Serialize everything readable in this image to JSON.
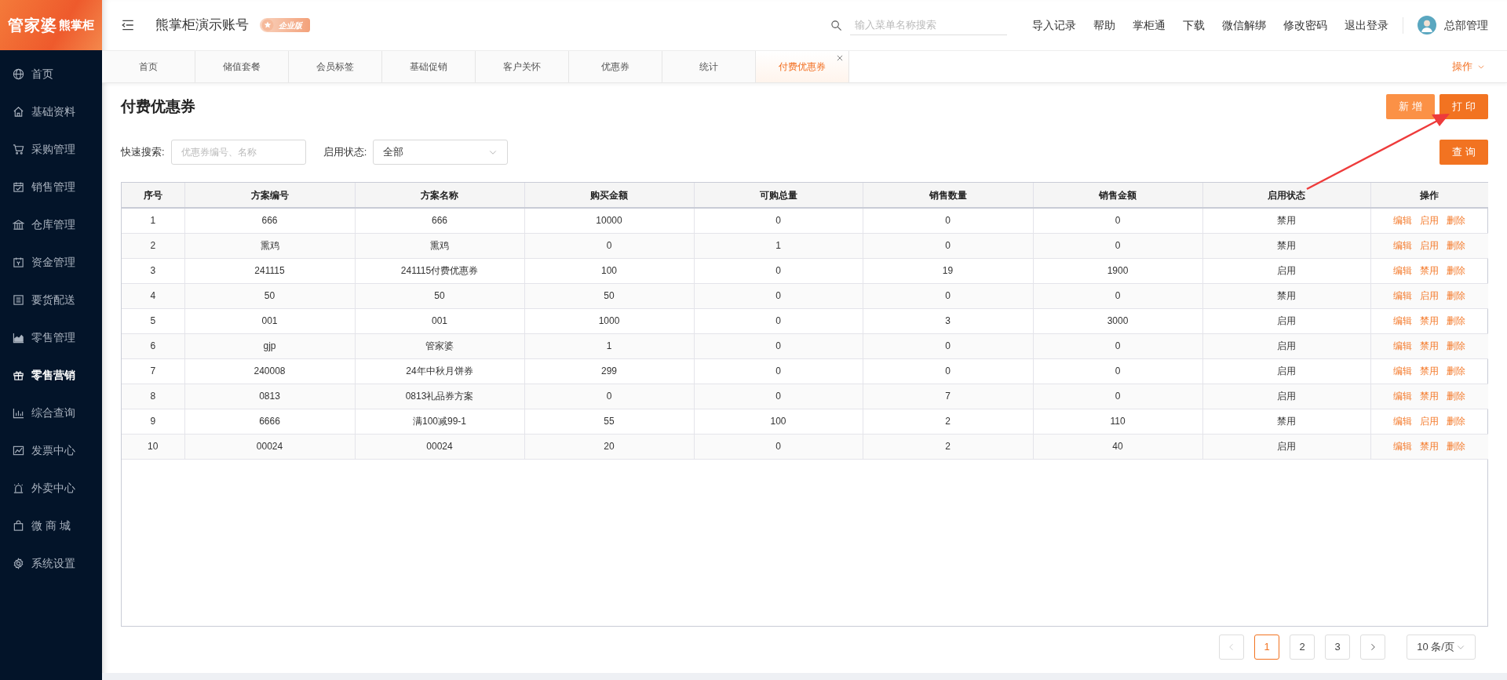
{
  "logo": {
    "brand": "管家婆",
    "product": "熊掌柜"
  },
  "sidebar": {
    "items": [
      {
        "label": "首页",
        "selected": false
      },
      {
        "label": "基础资料",
        "selected": false
      },
      {
        "label": "采购管理",
        "selected": false
      },
      {
        "label": "销售管理",
        "selected": false
      },
      {
        "label": "仓库管理",
        "selected": false
      },
      {
        "label": "资金管理",
        "selected": false
      },
      {
        "label": "要货配送",
        "selected": false
      },
      {
        "label": "零售管理",
        "selected": false
      },
      {
        "label": "零售营销",
        "selected": true
      },
      {
        "label": "综合查询",
        "selected": false
      },
      {
        "label": "发票中心",
        "selected": false
      },
      {
        "label": "外卖中心",
        "selected": false
      },
      {
        "label": "微 商 城",
        "selected": false
      },
      {
        "label": "系统设置",
        "selected": false
      }
    ]
  },
  "header": {
    "account": "熊掌柜演示账号",
    "edition": "企业版",
    "search": {
      "placeholder": "输入菜单名称搜索"
    },
    "links": [
      "导入记录",
      "帮助",
      "掌柜通",
      "下载",
      "微信解绑",
      "修改密码",
      "退出登录"
    ],
    "user": "总部管理"
  },
  "tabs": [
    {
      "label": "首页",
      "selected": false,
      "closable": false
    },
    {
      "label": "储值套餐",
      "selected": false,
      "closable": false
    },
    {
      "label": "会员标签",
      "selected": false,
      "closable": false
    },
    {
      "label": "基础促销",
      "selected": false,
      "closable": false
    },
    {
      "label": "客户关怀",
      "selected": false,
      "closable": false
    },
    {
      "label": "优惠券",
      "selected": false,
      "closable": false
    },
    {
      "label": "统计",
      "selected": false,
      "closable": false
    },
    {
      "label": "付费优惠券",
      "selected": true,
      "closable": true
    }
  ],
  "tab_menu": "操作",
  "page": {
    "title": "付费优惠券",
    "buttons": [
      {
        "label": "新 增",
        "kind": "light"
      },
      {
        "label": "打 印",
        "kind": "primary"
      }
    ],
    "filters": {
      "search_label": "快速搜索:",
      "search_placeholder": "优惠券编号、名称",
      "status_label": "启用状态:",
      "status_value": "全部"
    },
    "query_button": "查 询"
  },
  "table": {
    "columns": [
      "序号",
      "方案编号",
      "方案名称",
      "购买金额",
      "可购总量",
      "销售数量",
      "销售金额",
      "启用状态",
      "操作"
    ],
    "rows": [
      {
        "cells": [
          "1",
          "666",
          "666",
          "10000",
          "0",
          "0",
          "0",
          "禁用"
        ],
        "actions": [
          "编辑",
          "启用",
          "删除"
        ]
      },
      {
        "cells": [
          "2",
          "熏鸡",
          "熏鸡",
          "0",
          "1",
          "0",
          "0",
          "禁用"
        ],
        "actions": [
          "编辑",
          "启用",
          "删除"
        ]
      },
      {
        "cells": [
          "3",
          "241115",
          "241115付费优惠券",
          "100",
          "0",
          "19",
          "1900",
          "启用"
        ],
        "actions": [
          "编辑",
          "禁用",
          "删除"
        ]
      },
      {
        "cells": [
          "4",
          "50",
          "50",
          "50",
          "0",
          "0",
          "0",
          "禁用"
        ],
        "actions": [
          "编辑",
          "启用",
          "删除"
        ]
      },
      {
        "cells": [
          "5",
          "001",
          "001",
          "1000",
          "0",
          "3",
          "3000",
          "启用"
        ],
        "actions": [
          "编辑",
          "禁用",
          "删除"
        ]
      },
      {
        "cells": [
          "6",
          "gjp",
          "管家婆",
          "1",
          "0",
          "0",
          "0",
          "启用"
        ],
        "actions": [
          "编辑",
          "禁用",
          "删除"
        ]
      },
      {
        "cells": [
          "7",
          "240008",
          "24年中秋月饼券",
          "299",
          "0",
          "0",
          "0",
          "启用"
        ],
        "actions": [
          "编辑",
          "禁用",
          "删除"
        ]
      },
      {
        "cells": [
          "8",
          "0813",
          "0813礼品券方案",
          "0",
          "0",
          "7",
          "0",
          "启用"
        ],
        "actions": [
          "编辑",
          "禁用",
          "删除"
        ]
      },
      {
        "cells": [
          "9",
          "6666",
          "满100减99-1",
          "55",
          "100",
          "2",
          "110",
          "禁用"
        ],
        "actions": [
          "编辑",
          "启用",
          "删除"
        ]
      },
      {
        "cells": [
          "10",
          "00024",
          "00024",
          "20",
          "0",
          "2",
          "40",
          "启用"
        ],
        "actions": [
          "编辑",
          "禁用",
          "删除"
        ]
      }
    ]
  },
  "pagination": {
    "prev_disabled": true,
    "pages": [
      {
        "label": "1",
        "selected": true
      },
      {
        "label": "2",
        "selected": false
      },
      {
        "label": "3",
        "selected": false
      }
    ],
    "page_size": "10 条/页"
  }
}
